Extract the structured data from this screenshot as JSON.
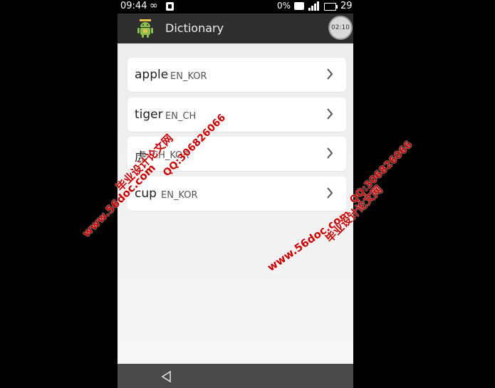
{
  "status_bar": {
    "time": "09:44",
    "infinity": "∞",
    "percent": "0%",
    "battery": "29"
  },
  "action_bar": {
    "title": "Dictionary",
    "timer": "02:10",
    "icon": "android-icon"
  },
  "entries": [
    {
      "word": "apple",
      "lang": "EN_KOR"
    },
    {
      "word": "tiger",
      "lang": "EN_CH"
    },
    {
      "word": "虎",
      "lang": "CH_KOR"
    },
    {
      "word": "cup",
      "lang": "EN_KOR"
    }
  ],
  "watermarks": {
    "site": "www.56doc.com",
    "name": "毕业设计论文网",
    "qq": "QQ:306826066"
  },
  "colors": {
    "action_bar": "#2e2e2e",
    "background": "#f2f2f2",
    "watermark": "#cc0000",
    "nav_bar": "#4a4a4a"
  }
}
